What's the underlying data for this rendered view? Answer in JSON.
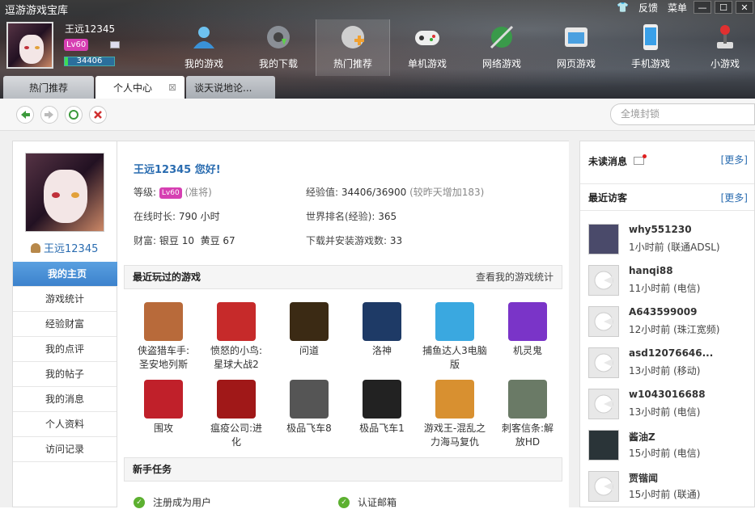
{
  "app": {
    "title": "逗游游戏宝库"
  },
  "window": {
    "skin": "👕",
    "feedback": "反馈",
    "menu": "菜单",
    "minimize": "—",
    "maximize": "☐",
    "close": "✕"
  },
  "user": {
    "name": "王远12345",
    "level": "Lv60",
    "exp_display": "34406"
  },
  "nav": [
    {
      "label": "我的游戏"
    },
    {
      "label": "我的下载"
    },
    {
      "label": "热门推荐"
    },
    {
      "label": "单机游戏"
    },
    {
      "label": "网络游戏"
    },
    {
      "label": "网页游戏"
    },
    {
      "label": "手机游戏"
    },
    {
      "label": "小游戏"
    }
  ],
  "tabs": [
    {
      "label": "热门推荐"
    },
    {
      "label": "个人中心",
      "close": "⊠"
    },
    {
      "label": "谈天说地论..."
    }
  ],
  "toolbar": {
    "search_placeholder": "全境封锁"
  },
  "sidebar": {
    "username": "王远12345",
    "items": [
      "我的主页",
      "游戏统计",
      "经验财富",
      "我的点评",
      "我的帖子",
      "我的消息",
      "个人资料",
      "访问记录"
    ]
  },
  "profile": {
    "greeting": "王远12345 您好!",
    "level_label": "等级:",
    "level_badge": "Lv60",
    "level_title": "(准将)",
    "exp_label": "经验值:",
    "exp_value": "34406/36900",
    "exp_note": "(较昨天增加183)",
    "online_label": "在线时长:",
    "online_value": "790 小时",
    "rank_label": "世界排名(经验):",
    "rank_value": "365",
    "wealth_label": "财富:",
    "wealth_value": "银豆 10  黄豆 67",
    "downloads_label": "下载并安装游戏数:",
    "downloads_value": "33"
  },
  "recent_games": {
    "title": "最近玩过的游戏",
    "more": "查看我的游戏统计",
    "items": [
      {
        "name": "侠盗猎车手:\n圣安地列斯",
        "color": "#b86a3a"
      },
      {
        "name": "愤怒的小鸟:\n星球大战2",
        "color": "#c62a2a"
      },
      {
        "name": "问道",
        "color": "#3b2a14"
      },
      {
        "name": "洛神",
        "color": "#1e3a66"
      },
      {
        "name": "捕鱼达人3电脑\n版",
        "color": "#3aa8e0"
      },
      {
        "name": "机灵鬼",
        "color": "#7a34c8"
      },
      {
        "name": "围攻",
        "color": "#c0202a"
      },
      {
        "name": "瘟疫公司:进\n化",
        "color": "#a01818"
      },
      {
        "name": "极品飞车8",
        "color": "#555555"
      },
      {
        "name": "极品飞车1",
        "color": "#222222"
      },
      {
        "name": "游戏王-混乱之\n力海马复仇",
        "color": "#d89030"
      },
      {
        "name": "刺客信条:解\n放HD",
        "color": "#6a7a66"
      }
    ]
  },
  "tasks": {
    "title": "新手任务",
    "items": [
      "注册成为用户",
      "认证邮箱"
    ]
  },
  "messages": {
    "title": "未读消息",
    "more": "[更多]"
  },
  "visitors": {
    "title": "最近访客",
    "more": "[更多]",
    "items": [
      {
        "name": "why551230",
        "meta": "1小时前 (联通ADSL)"
      },
      {
        "name": "hanqi88",
        "meta": "11小时前 (电信)"
      },
      {
        "name": "A643599009",
        "meta": "12小时前 (珠江宽频)"
      },
      {
        "name": "asd12076646...",
        "meta": "13小时前 (移动)"
      },
      {
        "name": "w1043016688",
        "meta": "13小时前 (电信)"
      },
      {
        "name": "酱油Z",
        "meta": "15小时前 (电信)"
      },
      {
        "name": "贾锴闻",
        "meta": "15小时前 (联通)"
      }
    ]
  }
}
